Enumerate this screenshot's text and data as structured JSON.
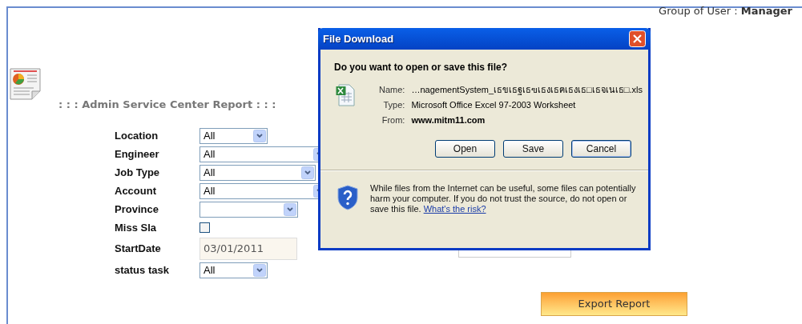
{
  "header": {
    "group_label": "Group of User : ",
    "group_value": "Manager"
  },
  "report": {
    "title": ": : : Admin Service Center Report : : :"
  },
  "form": {
    "fields": [
      {
        "label": "Location",
        "kind": "select",
        "value": "All"
      },
      {
        "label": "Engineer",
        "kind": "select",
        "value": "All"
      },
      {
        "label": "Job Type",
        "kind": "select",
        "value": "All"
      },
      {
        "label": "Account",
        "kind": "select",
        "value": "All"
      },
      {
        "label": "Province",
        "kind": "select"
      },
      {
        "label": "Miss Sla",
        "kind": "checkbox",
        "checked": false
      },
      {
        "label": "StartDate",
        "kind": "date",
        "value": "03/01/2011"
      },
      {
        "label": "status task",
        "kind": "select",
        "value": "All"
      }
    ]
  },
  "export_button": "Export Report",
  "dialog": {
    "title": "File Download",
    "question": "Do you want to open or save this file?",
    "details": [
      {
        "label": "Name:",
        "value": "…nagementSystem_เธขเธฐเธฃเธงเธฅเธงเธ□เธจเนเธ□.xls",
        "bold": false
      },
      {
        "label": "Type:",
        "value": "Microsoft Office Excel 97-2003 Worksheet",
        "bold": false
      },
      {
        "label": "From:",
        "value": "www.mitm11.com",
        "bold": true
      }
    ],
    "buttons": [
      "Open",
      "Save",
      "Cancel"
    ],
    "warning": "While files from the Internet can be useful, some files can potentially harm your computer. If you do not trust the source, do not open or save this file.",
    "risk_link": "What's the risk?"
  }
}
